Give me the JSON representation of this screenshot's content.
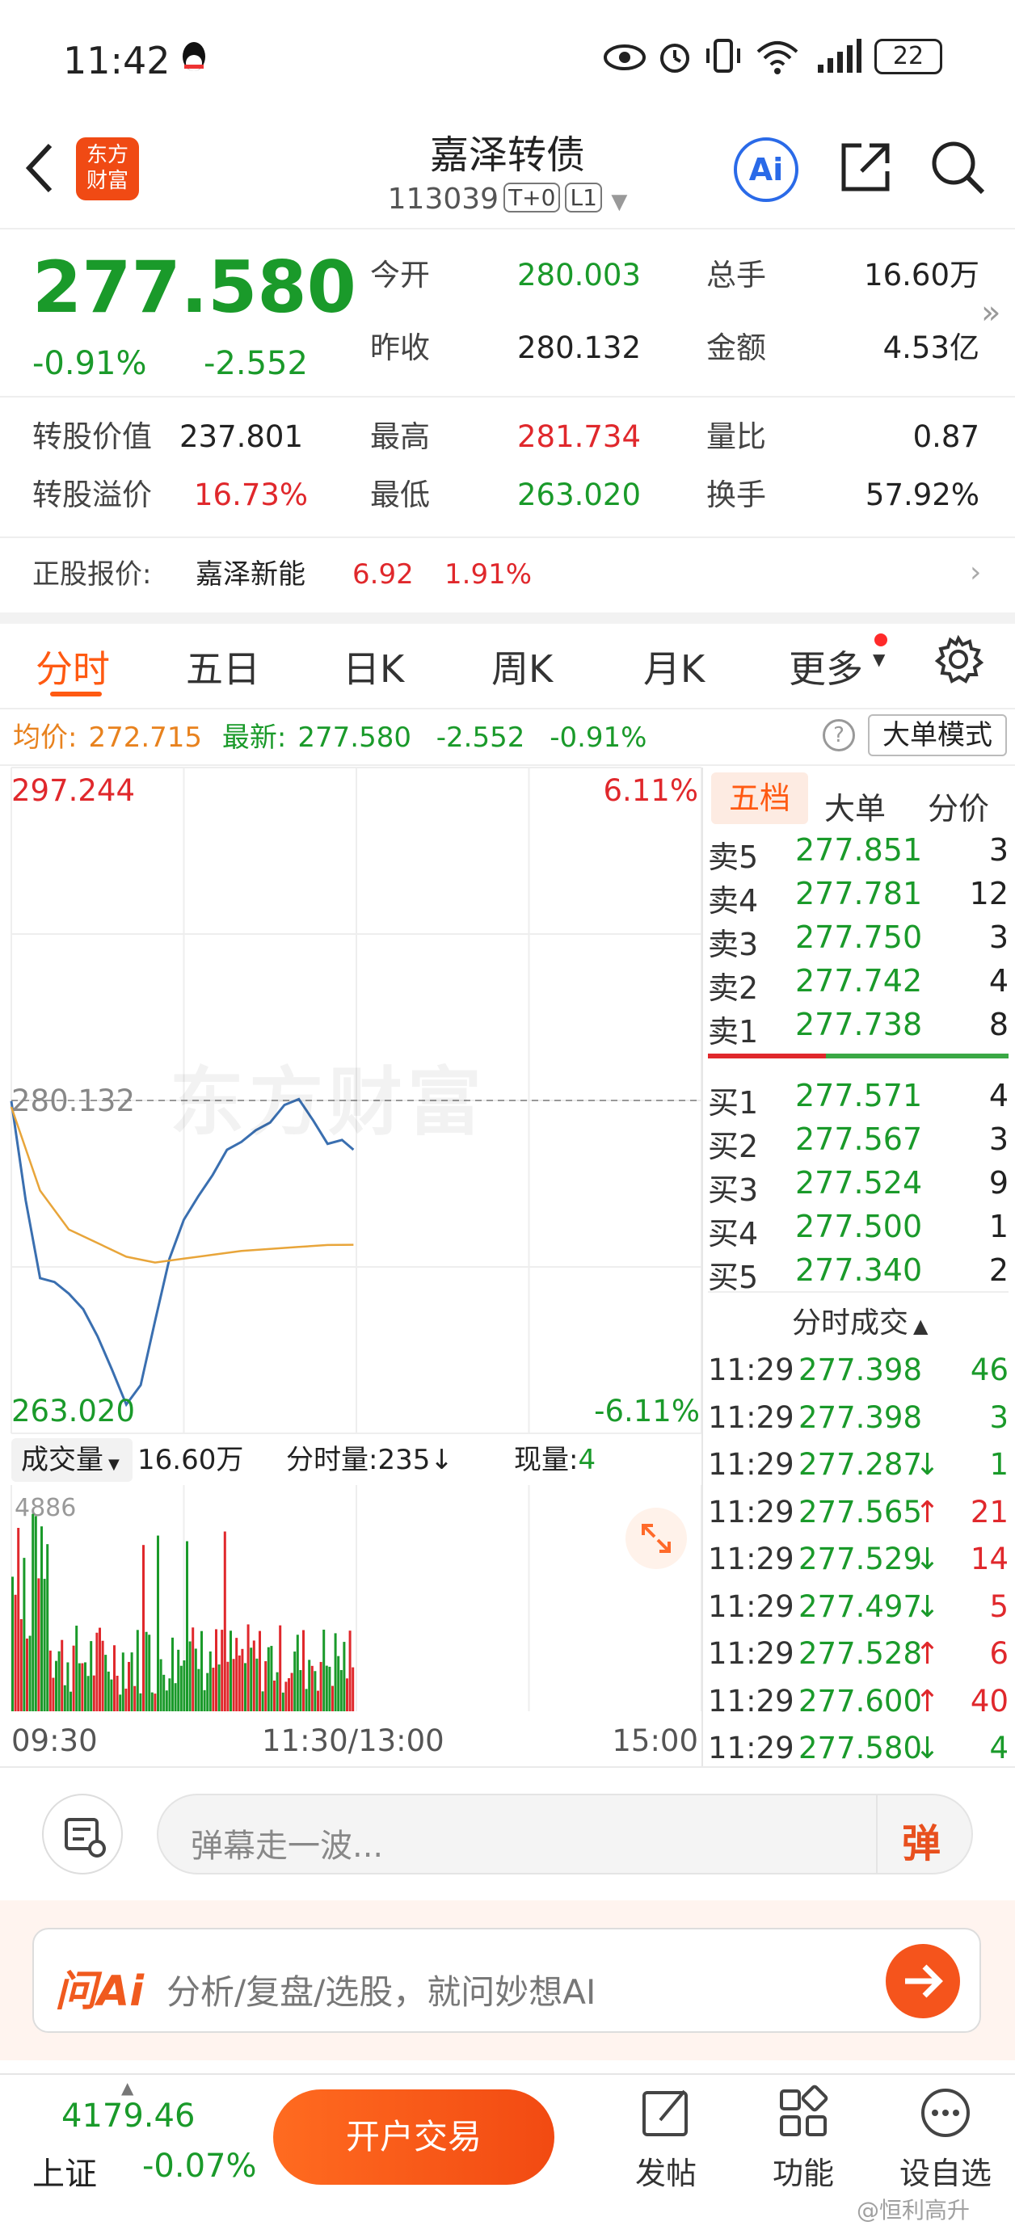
{
  "status_bar": {
    "time": "11:42",
    "battery": "22"
  },
  "header": {
    "title": "嘉泽转债",
    "code": "113039",
    "tag1": "T+0",
    "tag2": "L1",
    "logo_line1": "东方",
    "logo_line2": "财富",
    "ai_label": "Ai"
  },
  "quote": {
    "price": "277.580",
    "change_pct": "-0.91%",
    "change": "-2.552",
    "open_label": "今开",
    "open": "280.003",
    "prev_label": "昨收",
    "prev": "280.132",
    "vol_label": "总手",
    "vol": "16.60万",
    "amt_label": "金额",
    "amt": "4.53亿",
    "conv_value_label": "转股价值",
    "conv_value": "237.801",
    "high_label": "最高",
    "high": "281.734",
    "ratio_label": "量比",
    "ratio": "0.87",
    "premium_label": "转股溢价",
    "premium": "16.73%",
    "low_label": "最低",
    "low": "263.020",
    "turnover_label": "换手",
    "turnover": "57.92%"
  },
  "underlying": {
    "label": "正股报价:",
    "name": "嘉泽新能",
    "price": "6.92",
    "pct": "1.91%"
  },
  "tabs": [
    "分时",
    "五日",
    "日K",
    "周K",
    "月K",
    "更多"
  ],
  "info_bar": {
    "avg_label": "均价:",
    "avg": "272.715",
    "latest_label": "最新:",
    "latest": "277.580",
    "chg": "-2.552",
    "pct": "-0.91%",
    "mode_button": "大单模式"
  },
  "chart": {
    "top_price": "297.244",
    "top_pct": "6.11%",
    "mid_price": "280.132",
    "bottom_price": "263.020",
    "bottom_pct": "-6.11%",
    "watermark": "东方财富",
    "vol_label": "成交量",
    "vol_total": "16.60万",
    "period_vol_label": "分时量:",
    "period_vol": "235",
    "now_vol_label": "现量:",
    "now_vol": "4",
    "vol_max": "4886",
    "time_start": "09:30",
    "time_mid": "11:30/13:00",
    "time_end": "15:00"
  },
  "chart_data": {
    "type": "line",
    "series": [
      {
        "x": [
          "09:30",
          "09:35",
          "09:40",
          "09:45",
          "09:50",
          "09:55",
          "10:00",
          "10:05",
          "10:10",
          "10:15",
          "10:20",
          "10:25",
          "10:30",
          "10:35",
          "10:40",
          "10:45",
          "10:50",
          "10:55",
          "11:00",
          "11:05",
          "11:10",
          "11:15",
          "11:20",
          "11:25",
          "11:29"
        ],
        "values": [
          280.1,
          275.0,
          271.0,
          270.8,
          270.2,
          269.4,
          268.0,
          266.3,
          264.5,
          265.5,
          268.8,
          272.0,
          274.0,
          275.2,
          276.3,
          277.6,
          278.0,
          278.6,
          279.0,
          279.9,
          280.2,
          279.1,
          277.9,
          278.1,
          277.6
        ]
      },
      {
        "x": [
          "09:30",
          "09:40",
          "09:50",
          "10:00",
          "10:10",
          "10:20",
          "10:30",
          "10:40",
          "10:50",
          "11:00",
          "11:10",
          "11:20",
          "11:29"
        ],
        "values": [
          279.8,
          275.5,
          273.5,
          272.8,
          272.1,
          271.8,
          272.0,
          272.2,
          272.4,
          272.5,
          272.6,
          272.7,
          272.715
        ]
      }
    ],
    "ylim": [
      263.02,
      297.244
    ]
  },
  "order_book": {
    "tabs": [
      "五档",
      "大单",
      "分价"
    ],
    "asks": [
      {
        "label": "卖5",
        "price": "277.851",
        "vol": "3"
      },
      {
        "label": "卖4",
        "price": "277.781",
        "vol": "12"
      },
      {
        "label": "卖3",
        "price": "277.750",
        "vol": "3"
      },
      {
        "label": "卖2",
        "price": "277.742",
        "vol": "4"
      },
      {
        "label": "卖1",
        "price": "277.738",
        "vol": "8"
      }
    ],
    "bids": [
      {
        "label": "买1",
        "price": "277.571",
        "vol": "4"
      },
      {
        "label": "买2",
        "price": "277.567",
        "vol": "3"
      },
      {
        "label": "买3",
        "price": "277.524",
        "vol": "9"
      },
      {
        "label": "买4",
        "price": "277.500",
        "vol": "1"
      },
      {
        "label": "买5",
        "price": "277.340",
        "vol": "2"
      }
    ],
    "trades_title": "分时成交",
    "trades": [
      {
        "time": "11:29",
        "price": "277.398",
        "arrow": "",
        "vol": "46",
        "dir": "buy"
      },
      {
        "time": "11:29",
        "price": "277.398",
        "arrow": "",
        "vol": "3",
        "dir": "buy"
      },
      {
        "time": "11:29",
        "price": "277.287",
        "arrow": "↓",
        "vol": "1",
        "dir": "buy"
      },
      {
        "time": "11:29",
        "price": "277.565",
        "arrow": "↑",
        "vol": "21",
        "dir": "sell"
      },
      {
        "time": "11:29",
        "price": "277.529",
        "arrow": "↓",
        "vol": "14",
        "dir": "sell"
      },
      {
        "time": "11:29",
        "price": "277.497",
        "arrow": "↓",
        "vol": "5",
        "dir": "sell"
      },
      {
        "time": "11:29",
        "price": "277.528",
        "arrow": "↑",
        "vol": "6",
        "dir": "sell"
      },
      {
        "time": "11:29",
        "price": "277.600",
        "arrow": "↑",
        "vol": "40",
        "dir": "sell"
      },
      {
        "time": "11:29",
        "price": "277.580",
        "arrow": "↓",
        "vol": "4",
        "dir": "buy"
      }
    ]
  },
  "comment": {
    "placeholder": "弹幕走一波...",
    "danmu": "弹"
  },
  "ai_bar": {
    "logo": "问Ai",
    "placeholder": "分析/复盘/选股，就问妙想AI"
  },
  "bottom_nav": {
    "index_value": "4179.46",
    "index_name": "上证",
    "index_pct": "-0.07%",
    "trade_button": "开户交易",
    "post": "发帖",
    "func": "功能",
    "custom": "设自选",
    "credit": "@恒利高升"
  },
  "colors": {
    "up": "#e0282c",
    "down": "#1a9a2a",
    "accent": "#ff5a12",
    "avg_line": "#e8a53a",
    "price_line": "#3a6fb0"
  }
}
